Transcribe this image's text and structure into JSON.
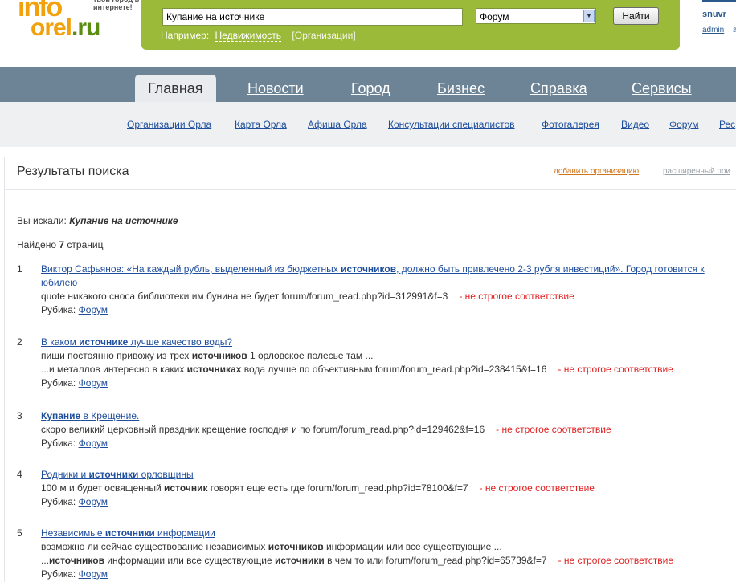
{
  "logo": {
    "part1": "info",
    "part2a": "orel",
    "part2b": ".ru",
    "tagline": "твой город в интернете!"
  },
  "search": {
    "query": "Купание на источнике",
    "section": "Форум",
    "button": "Найти",
    "example_label": "Например:",
    "example_link": "Недвижимость",
    "example_org": "[Организации]"
  },
  "user": {
    "name": "snuvr",
    "admin": "admin",
    "extra": "a"
  },
  "mainnav": [
    "Главная",
    "Новости",
    "Город",
    "Бизнес",
    "Справка",
    "Сервисы"
  ],
  "subnav": [
    "Организации Орла",
    "Карта Орла",
    "Афиша Орла",
    "Консультации специалистов",
    "Фотогалерея",
    "Видео",
    "Форум",
    "Рес"
  ],
  "page": {
    "title": "Результаты поиска",
    "add_org": "добавить организацию",
    "adv_search": "расширенный пои",
    "query_label": "Вы искали:",
    "query_value": "Купание на источнике",
    "found_prefix": "Найдено",
    "found_count": "7",
    "found_suffix": "страниц",
    "rubric_label": "Рубика:",
    "match_note": "- не строгое соответствие"
  },
  "results": [
    {
      "num": "1",
      "title_parts": [
        {
          "t": "Виктор Сафьянов: «На каждый рубль, выделенный из бюджетных ",
          "b": false
        },
        {
          "t": "источников",
          "b": true
        },
        {
          "t": ", должно быть привлечено 2-3 рубля инвестиций». Город готовится к",
          "b": false
        }
      ],
      "title_line2": "юбилею",
      "snippets": [
        [
          {
            "t": "quote никакого сноса библиотеки им бунина не будет forum/forum_read.php?id=312991&f=3",
            "b": false
          }
        ]
      ],
      "rubric": "Форум"
    },
    {
      "num": "2",
      "title_parts": [
        {
          "t": "В каком ",
          "b": false
        },
        {
          "t": "источнике",
          "b": true
        },
        {
          "t": " лучше качество воды?",
          "b": false
        }
      ],
      "title_line2": "",
      "snippets": [
        [
          {
            "t": "пищи постоянно привожу из трех ",
            "b": false
          },
          {
            "t": "источников",
            "b": true
          },
          {
            "t": " 1 орловское полесье там ...",
            "b": false
          }
        ],
        [
          {
            "t": "...и металлов интересно в каких ",
            "b": false
          },
          {
            "t": "источниках",
            "b": true
          },
          {
            "t": " вода лучше по объективным forum/forum_read.php?id=238415&f=16",
            "b": false
          }
        ]
      ],
      "rubric": "Форум"
    },
    {
      "num": "3",
      "title_parts": [
        {
          "t": "Купание",
          "b": true
        },
        {
          "t": " в Крещение.",
          "b": false
        }
      ],
      "title_line2": "",
      "snippets": [
        [
          {
            "t": "скоро великий церковный праздник крещение господня и по forum/forum_read.php?id=129462&f=16",
            "b": false
          }
        ]
      ],
      "rubric": "Форум"
    },
    {
      "num": "4",
      "title_parts": [
        {
          "t": "Родники и ",
          "b": false
        },
        {
          "t": "источники",
          "b": true
        },
        {
          "t": " орловщины",
          "b": false
        }
      ],
      "title_line2": "",
      "snippets": [
        [
          {
            "t": "100 м и будет освященный ",
            "b": false
          },
          {
            "t": "источник",
            "b": true
          },
          {
            "t": " говорят еще есть где forum/forum_read.php?id=78100&f=7",
            "b": false
          }
        ]
      ],
      "rubric": "Форум"
    },
    {
      "num": "5",
      "title_parts": [
        {
          "t": "Независимые ",
          "b": false
        },
        {
          "t": "источники",
          "b": true
        },
        {
          "t": " информации",
          "b": false
        }
      ],
      "title_line2": "",
      "snippets": [
        [
          {
            "t": "возможно ли сейчас существование независимых ",
            "b": false
          },
          {
            "t": "источников",
            "b": true
          },
          {
            "t": " информации или все существующие ...",
            "b": false
          }
        ],
        [
          {
            "t": "...",
            "b": false
          },
          {
            "t": "источников",
            "b": true
          },
          {
            "t": " информации или все существующие ",
            "b": false
          },
          {
            "t": "источники",
            "b": true
          },
          {
            "t": " в чем то или forum/forum_read.php?id=65739&f=7",
            "b": false
          }
        ]
      ],
      "rubric": "Форум"
    }
  ]
}
